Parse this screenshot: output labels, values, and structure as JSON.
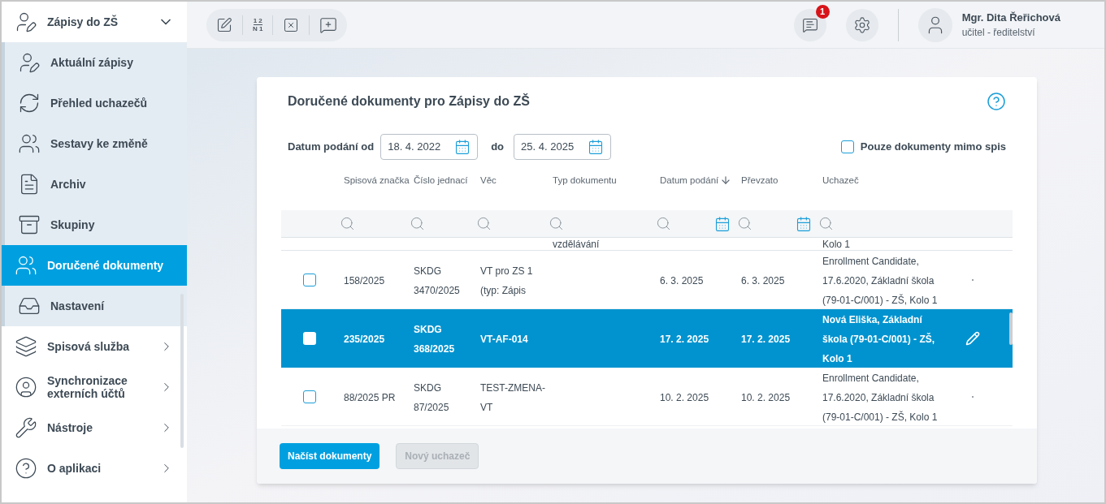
{
  "sidebar": {
    "items": [
      {
        "kind": "group",
        "label": "Zápisy do ZŠ",
        "expanded": true,
        "selected": false
      },
      {
        "kind": "sub",
        "label": "Aktuální zápisy",
        "selected": false
      },
      {
        "kind": "sub",
        "label": "Přehled uchazečů",
        "selected": false
      },
      {
        "kind": "sub",
        "label": "Sestavy ke změně",
        "selected": false
      },
      {
        "kind": "sub",
        "label": "Archiv",
        "selected": false
      },
      {
        "kind": "sub",
        "label": "Skupiny",
        "selected": false
      },
      {
        "kind": "sub",
        "label": "Doručené dokumenty",
        "selected": true
      },
      {
        "kind": "sub",
        "label": "Nastavení",
        "selected": false
      },
      {
        "kind": "group",
        "label": "Spisová služba",
        "expanded": false,
        "selected": false
      },
      {
        "kind": "group",
        "label": "Synchronizace externích účtů",
        "expanded": false,
        "selected": false
      },
      {
        "kind": "group",
        "label": "Nástroje",
        "expanded": false,
        "selected": false
      },
      {
        "kind": "group",
        "label": "O aplikaci",
        "expanded": false,
        "selected": false
      }
    ]
  },
  "toolbar": {
    "numbering": {
      "top": "1 2",
      "bottom": "N 1"
    }
  },
  "header": {
    "notifications": "1",
    "user_name": "Mgr. Dita Řeřichová",
    "user_role": "učitel - ředitelství"
  },
  "panel": {
    "title": "Doručené dokumenty pro Zápisy do ZŠ",
    "date_from_label": "Datum podání od",
    "date_from": "18. 4. 2022",
    "date_to_label": "do",
    "date_to": "25. 4. 2025",
    "only_outside_label": "Pouze dokumenty mimo spis",
    "only_outside": false,
    "columns": [
      {
        "kind": "text",
        "label": "Spisová značka",
        "sorted": false
      },
      {
        "kind": "text",
        "label": "Číslo jednací",
        "sorted": false
      },
      {
        "kind": "text",
        "label": "Věc",
        "sorted": false
      },
      {
        "kind": "text",
        "label": "Typ dokumentu",
        "sorted": false
      },
      {
        "kind": "date",
        "label": "Datum podání",
        "sorted": true
      },
      {
        "kind": "date",
        "label": "Převzato",
        "sorted": false
      },
      {
        "kind": "text",
        "label": "Uchazeč",
        "sorted": false
      }
    ],
    "partial_row": {
      "type": "vzdělávání",
      "candidate": "Kolo 1"
    },
    "rows": [
      {
        "selected": false,
        "checked": false,
        "file_mark": "158/2025",
        "ref_no": "SKDG 3470/2025",
        "subject": "VT pro ZS 1 (typ: Zápis",
        "filed": "6. 3. 2025",
        "taken": "6. 3. 2025",
        "candidate": "Enrollment Candidate, 17.6.2020, Základní škola (79-01-C/001) - ZŠ, Kolo 1"
      },
      {
        "selected": true,
        "checked": false,
        "file_mark": "235/2025",
        "ref_no": "SKDG 368/2025",
        "subject": "VT-AF-014",
        "filed": "17. 2. 2025",
        "taken": "17. 2. 2025",
        "candidate": "Nová Eliška, Základní škola (79-01-C/001) - ZŠ, Kolo 1"
      },
      {
        "selected": false,
        "checked": false,
        "file_mark": "88/2025 PR",
        "ref_no": "SKDG 87/2025",
        "subject": "TEST-ZMENA-VT",
        "filed": "10. 2. 2025",
        "taken": "10. 2. 2025",
        "candidate": "Enrollment Candidate, 17.6.2020, Základní škola (79-01-C/001) - ZŠ, Kolo 1"
      }
    ],
    "buttons": [
      {
        "label": "Načíst dokumenty",
        "disabled": false
      },
      {
        "label": "Nový uchazeč",
        "disabled": true
      }
    ]
  }
}
